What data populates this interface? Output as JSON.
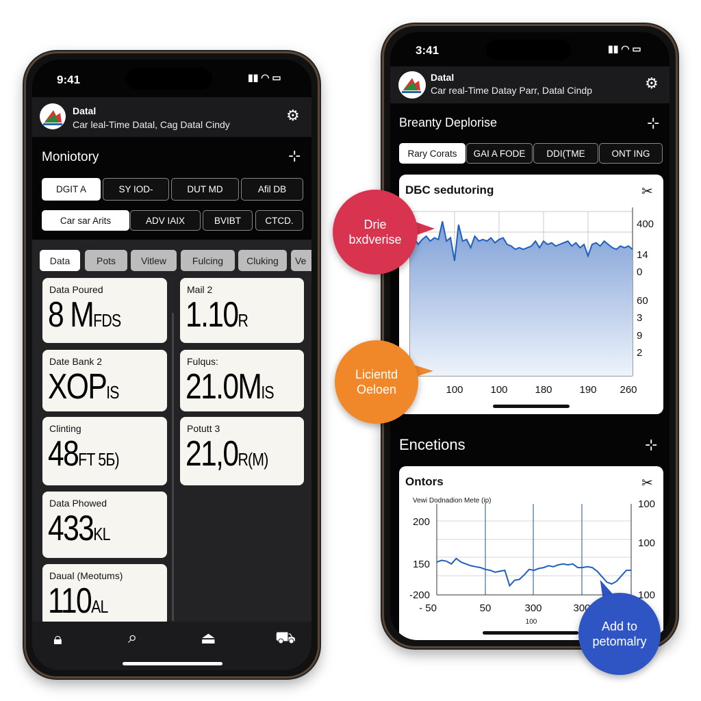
{
  "left_phone": {
    "status": {
      "time": "9:41"
    },
    "header": {
      "title": "Datal",
      "subtitle": "Car leal-Time Datal, Cag Datal Cindy",
      "settings_icon": "gear-icon"
    },
    "section_title": "Moniotory",
    "section_icon": "crosshair-icon",
    "tabs_row1": [
      {
        "label": "DGIT A",
        "active": true
      },
      {
        "label": "SY IOD-"
      },
      {
        "label": "DUT MD"
      },
      {
        "label": "Afil DB"
      }
    ],
    "tabs_row2": [
      {
        "label": "Car sar Arits",
        "active": true
      },
      {
        "label": "ADV IAIX"
      },
      {
        "label": "BVIBT"
      },
      {
        "label": "CTCD."
      }
    ],
    "chips": [
      {
        "label": "Data",
        "active": true
      },
      {
        "label": "Pots"
      },
      {
        "label": "Vitlew"
      },
      {
        "label": "Fulcing"
      },
      {
        "label": "Cluking"
      },
      {
        "label": "Ve"
      }
    ],
    "cards": [
      {
        "label": "Data Poured",
        "value": "8 M",
        "unit": "FDS"
      },
      {
        "label": "Mail 2",
        "value": "1.10",
        "unit": "R"
      },
      {
        "label": "Date Bank 2",
        "value": "XOP",
        "unit": "IS"
      },
      {
        "label": "Fulqus:",
        "value": "21.0M",
        "unit": "IS"
      },
      {
        "label": "Clinting",
        "value": "48",
        "unit": "FT 5Б)"
      },
      {
        "label": "Potutt 3",
        "value": "21,0",
        "unit": "R(M)"
      },
      {
        "label": "Data Phowed",
        "value": "433",
        "unit": "KL"
      },
      {
        "label": "Daual (Meotums)",
        "value": "110",
        "unit": "AL"
      }
    ],
    "nav": [
      "lock-icon",
      "search-icon",
      "inbox-icon",
      "car-icon"
    ]
  },
  "right_phone": {
    "status": {
      "time": "3:41"
    },
    "header": {
      "title": "Datal",
      "subtitle": "Car real-Time Datay Parr, Datal Cindp",
      "settings_icon": "gear-icon"
    },
    "section1_title": "Breanty Deplorise",
    "tabs": [
      {
        "label": "Rary Corats",
        "active": true
      },
      {
        "label": "GAI A FODE"
      },
      {
        "label": "DDI(TME"
      },
      {
        "label": "ONT ING"
      }
    ],
    "section2_title": "Encetions"
  },
  "callouts": {
    "red": {
      "text": "Drie bxdverise",
      "color": "#d8344f"
    },
    "orange": {
      "text": "Licientd Oeloen",
      "color": "#f0882a"
    },
    "blue": {
      "text": "Add to petomalry",
      "color": "#2f55c4"
    }
  },
  "chart_data": [
    {
      "type": "area",
      "title": "DБC sedutoring",
      "x_tick_labels": [
        "100",
        "100",
        "180",
        "190",
        "260"
      ],
      "y_tick_labels_right": [
        "400",
        "14",
        "0",
        "60",
        "3",
        "9",
        "2"
      ],
      "ylim": [
        0,
        100
      ],
      "grid": true,
      "color": "#1f5fbf",
      "values": [
        82,
        84,
        80,
        83,
        85,
        82,
        84,
        83,
        94,
        82,
        84,
        70,
        92,
        82,
        83,
        78,
        85,
        82,
        83,
        82,
        84,
        81,
        83,
        84,
        80,
        79,
        77,
        78,
        77,
        78,
        79,
        82,
        78,
        82,
        80,
        81,
        79,
        80,
        81,
        82,
        79,
        81,
        78,
        80,
        73,
        80,
        81,
        79,
        82,
        80,
        78,
        77,
        79,
        78,
        79,
        77
      ]
    },
    {
      "type": "line",
      "title": "Ontors",
      "subtitle": "Vewi Dodnadion Mete (ip)",
      "x_tick_labels": [
        "- 50",
        "50",
        "300",
        "300"
      ],
      "x_sub_label": "100",
      "y_tick_labels_left": [
        "200",
        "150",
        "-200"
      ],
      "y_tick_labels_right": [
        "100",
        "100",
        "100"
      ],
      "ylim": [
        0,
        100
      ],
      "grid": true,
      "color": "#1f5fbf",
      "values": [
        36,
        38,
        37,
        34,
        40,
        36,
        34,
        32,
        31,
        30,
        28,
        27,
        25,
        26,
        27,
        10,
        16,
        17,
        22,
        28,
        27,
        29,
        30,
        32,
        31,
        33,
        34,
        33,
        34,
        30,
        30,
        31,
        30,
        26,
        20,
        14,
        12,
        15,
        21,
        27,
        27
      ]
    }
  ]
}
